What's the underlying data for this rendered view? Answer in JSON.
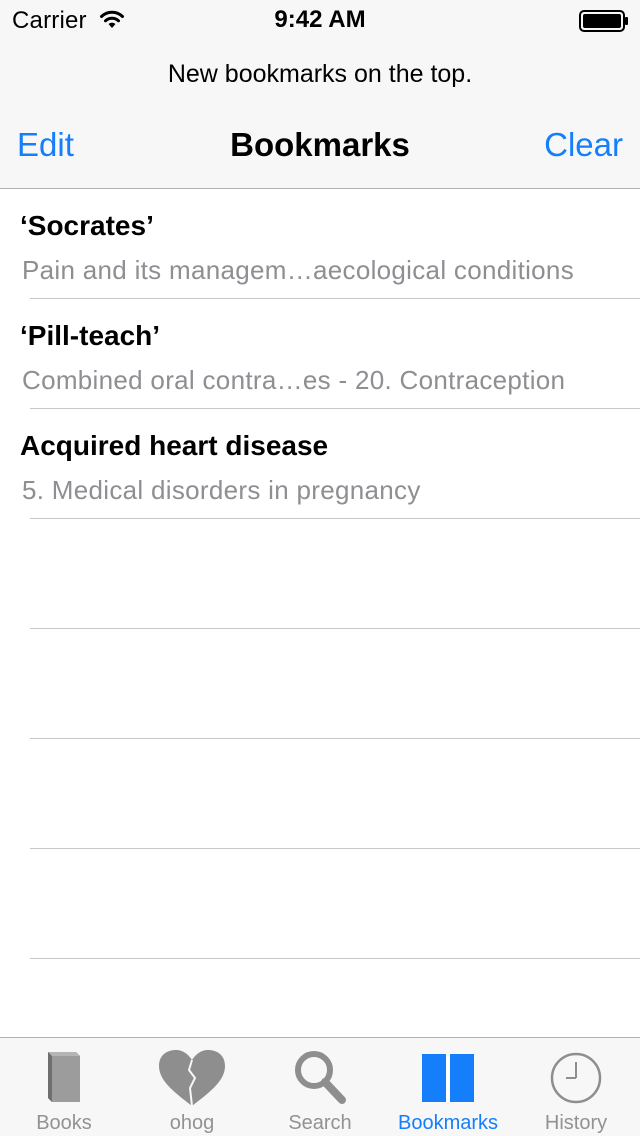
{
  "status_bar": {
    "carrier": "Carrier",
    "time": "9:42 AM"
  },
  "header": {
    "prompt": "New bookmarks on the top.",
    "edit_label": "Edit",
    "title": "Bookmarks",
    "clear_label": "Clear"
  },
  "bookmarks": [
    {
      "title": "‘Socrates’",
      "subtitle": "Pain and its managem…aecological conditions"
    },
    {
      "title": "‘Pill-teach’",
      "subtitle": "Combined oral contra…es - 20. Contraception"
    },
    {
      "title": "Acquired heart disease",
      "subtitle": "5. Medical disorders in pregnancy"
    }
  ],
  "tabs": [
    {
      "label": "Books",
      "icon": "book-icon",
      "active": false
    },
    {
      "label": "ohog",
      "icon": "heart-icon",
      "active": false
    },
    {
      "label": "Search",
      "icon": "magnifier-icon",
      "active": false
    },
    {
      "label": "Bookmarks",
      "icon": "open-book-icon",
      "active": true
    },
    {
      "label": "History",
      "icon": "clock-icon",
      "active": false
    }
  ],
  "colors": {
    "accent": "#157efb",
    "inactive_tab": "#929292",
    "subtitle": "#8e8e93"
  }
}
